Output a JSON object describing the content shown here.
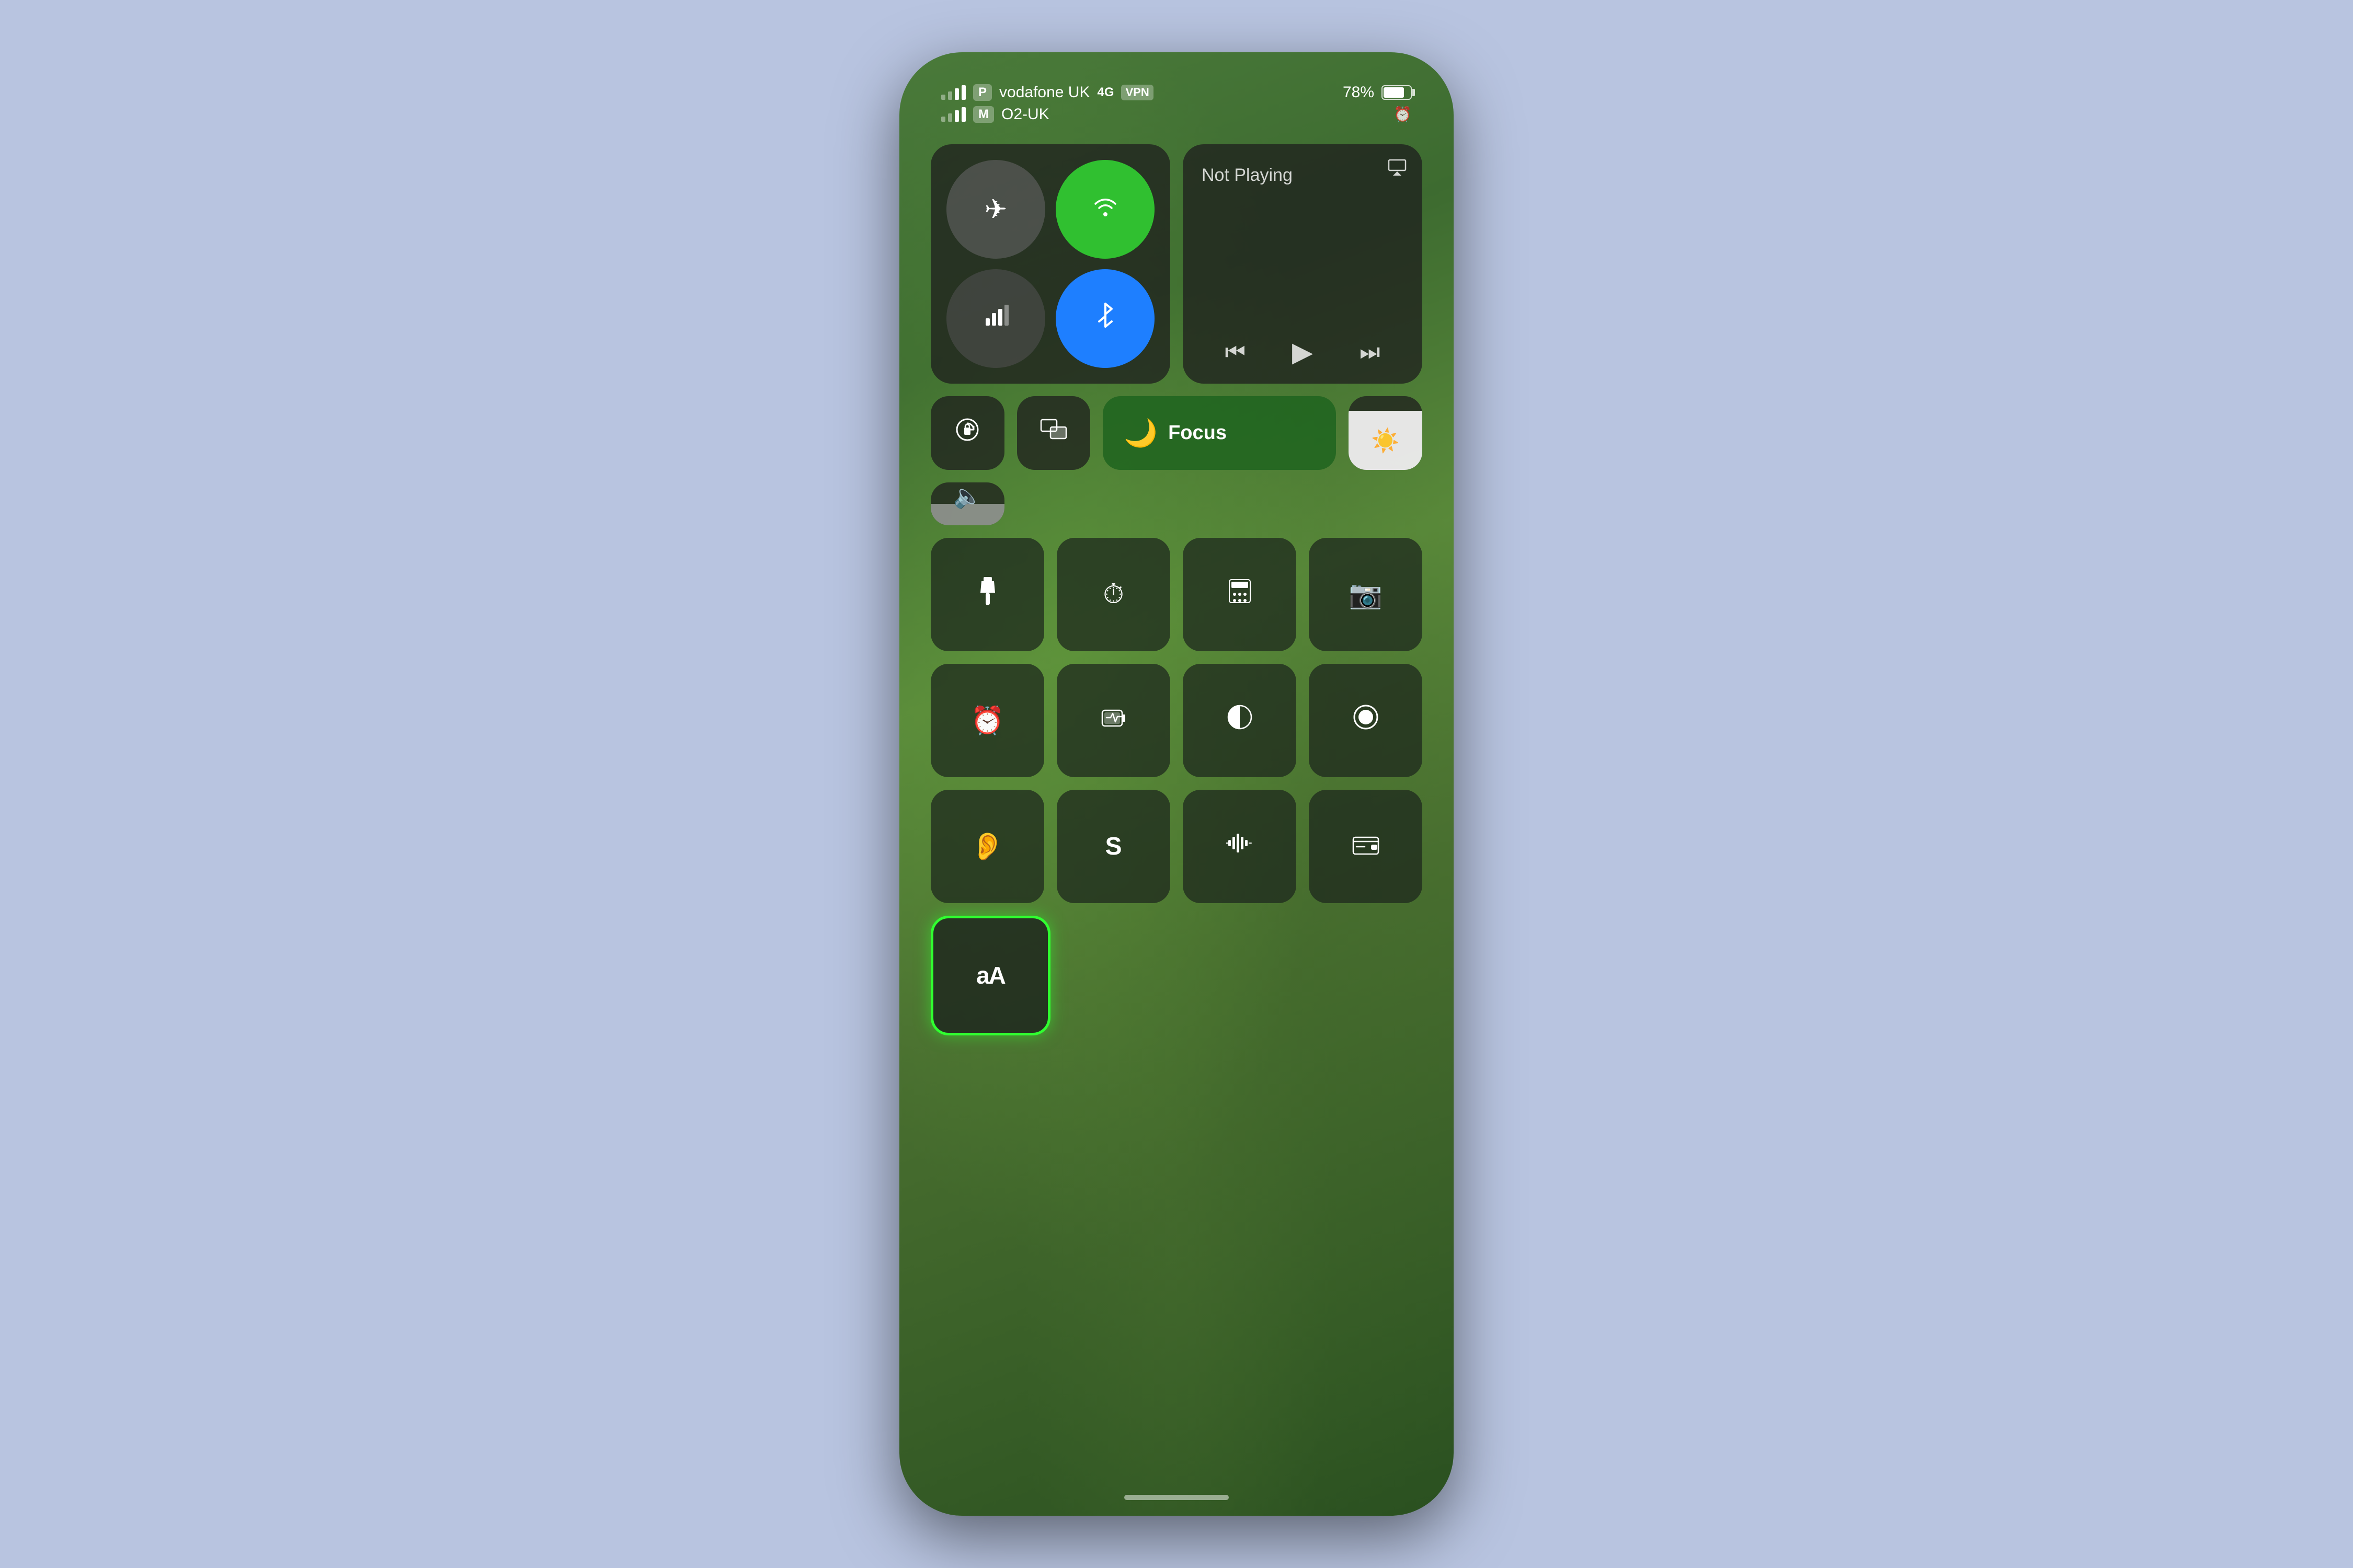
{
  "background_color": "#b8c4e0",
  "status_bar": {
    "signal1": {
      "carrier_badge": "P",
      "carrier": "vodafone UK",
      "network": "4G",
      "vpn": "VPN"
    },
    "signal2": {
      "carrier_badge": "M",
      "carrier": "O2-UK"
    },
    "battery_percent": "78%",
    "has_alarm": true
  },
  "control_center": {
    "connectivity": {
      "airplane_mode": false,
      "wifi": true,
      "cellular": true,
      "bluetooth": true
    },
    "now_playing": {
      "label": "Not Playing",
      "airplay": true
    },
    "media_controls": {
      "rewind": "«",
      "play": "▶",
      "forward": "»"
    },
    "quick_tiles": [
      {
        "id": "orientation-lock",
        "icon": "🔒",
        "label": "Orientation Lock"
      },
      {
        "id": "screen-mirror",
        "icon": "⧉",
        "label": "Screen Mirroring"
      },
      {
        "id": "focus",
        "icon": "🌙",
        "label": "Focus",
        "text": "Focus",
        "active": true
      },
      {
        "id": "brightness",
        "icon": "☀",
        "label": "Brightness",
        "fill": 80
      },
      {
        "id": "volume",
        "icon": "🔈",
        "label": "Volume",
        "fill": 50
      }
    ],
    "action_row1": [
      {
        "id": "flashlight",
        "icon": "🔦",
        "label": "Flashlight"
      },
      {
        "id": "timer",
        "icon": "⏱",
        "label": "Timer"
      },
      {
        "id": "calculator",
        "icon": "🔢",
        "label": "Calculator"
      },
      {
        "id": "camera",
        "icon": "📷",
        "label": "Camera"
      }
    ],
    "action_row2": [
      {
        "id": "alarm",
        "icon": "⏰",
        "label": "Alarm"
      },
      {
        "id": "battery-health",
        "icon": "🔋",
        "label": "Battery Health"
      },
      {
        "id": "dark-mode",
        "icon": "◑",
        "label": "Dark Mode"
      },
      {
        "id": "screen-record",
        "icon": "⏺",
        "label": "Screen Recording"
      }
    ],
    "action_row3": [
      {
        "id": "hearing",
        "icon": "👂",
        "label": "Hearing"
      },
      {
        "id": "shazam",
        "icon": "S",
        "label": "Shazam"
      },
      {
        "id": "voice-recognition",
        "icon": "📊",
        "label": "Voice Recognition"
      },
      {
        "id": "wallet",
        "icon": "💳",
        "label": "Wallet"
      }
    ],
    "bottom": [
      {
        "id": "text-size",
        "icon": "aA",
        "label": "Text Size",
        "highlighted": true
      }
    ]
  },
  "home_indicator": true
}
